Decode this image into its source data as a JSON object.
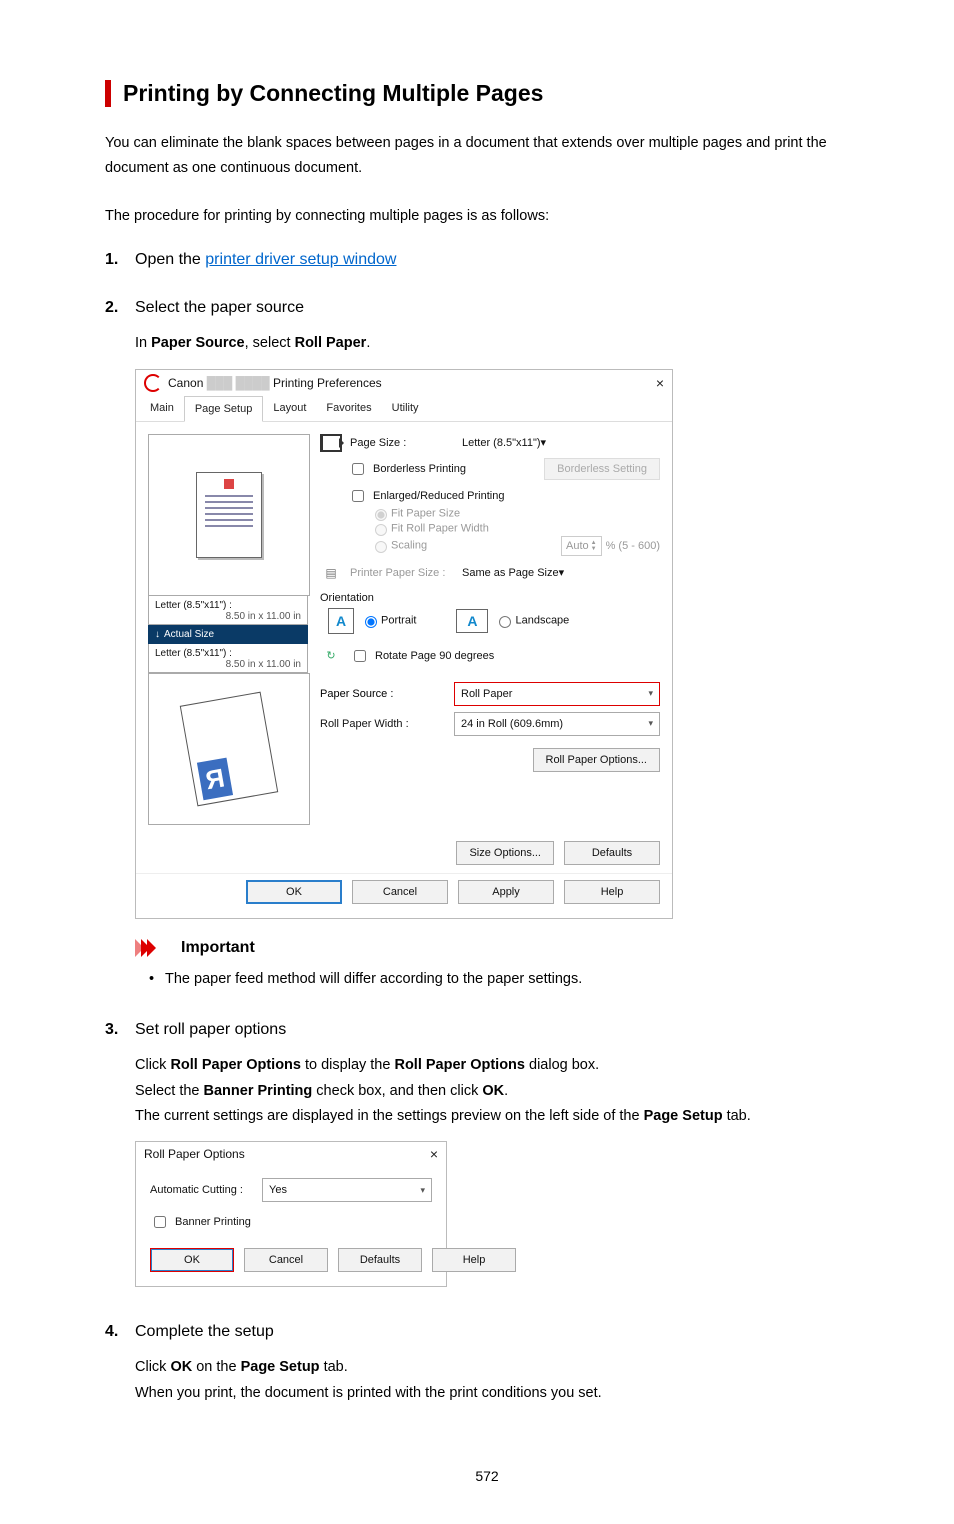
{
  "title": "Printing by Connecting Multiple Pages",
  "intro1": "You can eliminate the blank spaces between pages in a document that extends over multiple pages and print the document as one continuous document.",
  "intro2": "The procedure for printing by connecting multiple pages is as follows:",
  "steps": [
    {
      "num": "1.",
      "head_prefix": "Open the ",
      "head_link": "printer driver setup window"
    },
    {
      "num": "2.",
      "head": "Select the paper source",
      "sub_prefix": "In ",
      "sub_bold1": "Paper Source",
      "sub_mid": ", select ",
      "sub_bold2": "Roll Paper",
      "sub_suffix": "."
    },
    {
      "num": "3.",
      "head": "Set roll paper options",
      "p1_a": "Click ",
      "p1_b": "Roll Paper Options",
      "p1_c": " to display the ",
      "p1_d": "Roll Paper Options",
      "p1_e": " dialog box.",
      "p2_a": "Select the ",
      "p2_b": "Banner Printing",
      "p2_c": " check box, and then click ",
      "p2_d": "OK",
      "p2_e": ".",
      "p3_a": "The current settings are displayed in the settings preview on the left side of the ",
      "p3_b": "Page Setup",
      "p3_c": " tab."
    },
    {
      "num": "4.",
      "head": "Complete the setup",
      "p1_a": "Click ",
      "p1_b": "OK",
      "p1_c": " on the ",
      "p1_d": "Page Setup",
      "p1_e": " tab.",
      "p2": "When you print, the document is printed with the print conditions you set."
    }
  ],
  "important": {
    "label": "Important",
    "bullet": "The paper feed method will differ according to the paper settings."
  },
  "ui1": {
    "title_prefix": "Canon",
    "title_mid_1": "███",
    "title_mid_2": "████",
    "title_suffix": "Printing Preferences",
    "tabs": [
      "Main",
      "Page Setup",
      "Layout",
      "Favorites",
      "Utility"
    ],
    "active_tab": 1,
    "page_size_label": "Page Size :",
    "page_size_value": "Letter (8.5\"x11\")",
    "borderless_printing": "Borderless Printing",
    "borderless_setting": "Borderless Setting",
    "enlarged_reduced": "Enlarged/Reduced Printing",
    "fit_paper_size": "Fit Paper Size",
    "fit_roll_width": "Fit Roll Paper Width",
    "scaling": "Scaling",
    "scaling_prefix": "Auto",
    "scaling_suffix": "%  (5 - 600)",
    "printer_paper_size": "Printer Paper Size :",
    "printer_paper_size_value": "Same as Page Size",
    "orientation_label": "Orientation",
    "portrait": "Portrait",
    "landscape": "Landscape",
    "rotate90": "Rotate Page 90 degrees",
    "paper_source_label": "Paper Source :",
    "paper_source_value": "Roll Paper",
    "roll_width_label": "Roll Paper Width :",
    "roll_width_value": "24 in Roll (609.6mm)",
    "roll_paper_options": "Roll Paper Options...",
    "size_options": "Size Options...",
    "defaults": "Defaults",
    "ok": "OK",
    "cancel": "Cancel",
    "apply": "Apply",
    "help": "Help",
    "preview1_title": "Letter (8.5\"x11\") :",
    "preview1_dim": "8.50 in x 11.00 in",
    "actual_size": "Actual Size",
    "preview2_title": "Letter (8.5\"x11\") :",
    "preview2_dim": "8.50 in x 11.00 in"
  },
  "ui2": {
    "title": "Roll Paper Options",
    "auto_cut_label": "Automatic Cutting :",
    "auto_cut_value": "Yes",
    "banner_printing": "Banner Printing",
    "ok": "OK",
    "cancel": "Cancel",
    "defaults": "Defaults",
    "help": "Help"
  },
  "page_number": "572"
}
